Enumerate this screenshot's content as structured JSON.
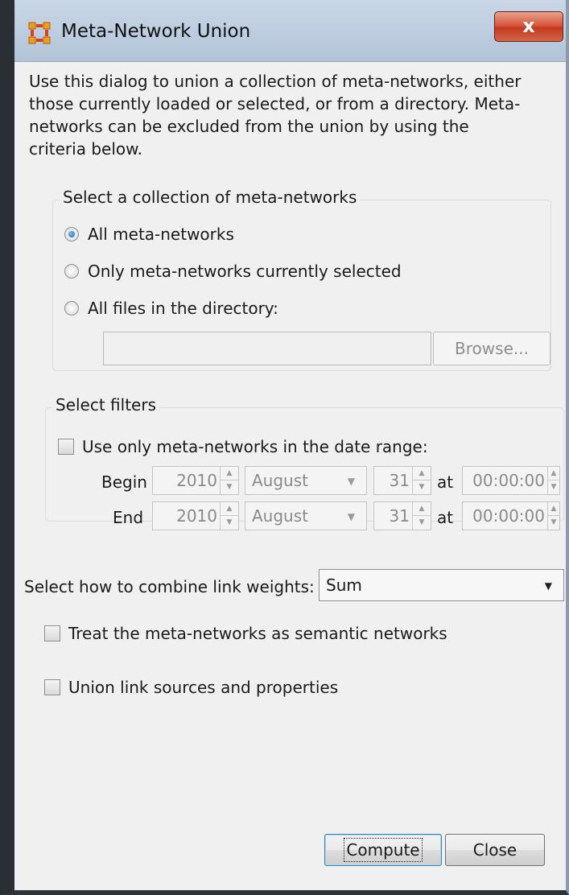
{
  "window": {
    "title": "Meta-Network Union",
    "close_label": "x"
  },
  "description": "Use this dialog to union a collection of meta-networks, either those currently loaded or selected, or from a directory. Meta-networks can be excluded from the union by using the criteria below.",
  "collection_group": {
    "title": "Select a collection of meta-networks",
    "options": [
      {
        "label": "All meta-networks",
        "checked": true
      },
      {
        "label": "Only meta-networks currently selected",
        "checked": false
      },
      {
        "label": "All files in the directory:",
        "checked": false
      }
    ],
    "directory_value": "",
    "browse_label": "Browse..."
  },
  "filters_group": {
    "title": "Select filters",
    "date_range_label": "Use only meta-networks in the date range:",
    "begin": {
      "label": "Begin",
      "year": "2010",
      "month": "August",
      "day": "31",
      "at": "at",
      "time": "00:00:00"
    },
    "end": {
      "label": "End",
      "year": "2010",
      "month": "August",
      "day": "31",
      "at": "at",
      "time": "00:00:00"
    }
  },
  "combine": {
    "label": "Select how to combine link weights:",
    "value": "Sum"
  },
  "semantic_label": "Treat the meta-networks as semantic networks",
  "union_sources_label": "Union link sources and properties",
  "buttons": {
    "compute": "Compute",
    "close": "Close"
  },
  "icons": {
    "app": "network-grid-icon",
    "close": "close-x-icon"
  },
  "colors": {
    "title_bar": "#bccbdc",
    "close_button": "#c9452b",
    "dialog_background": "#f0f0f0"
  }
}
